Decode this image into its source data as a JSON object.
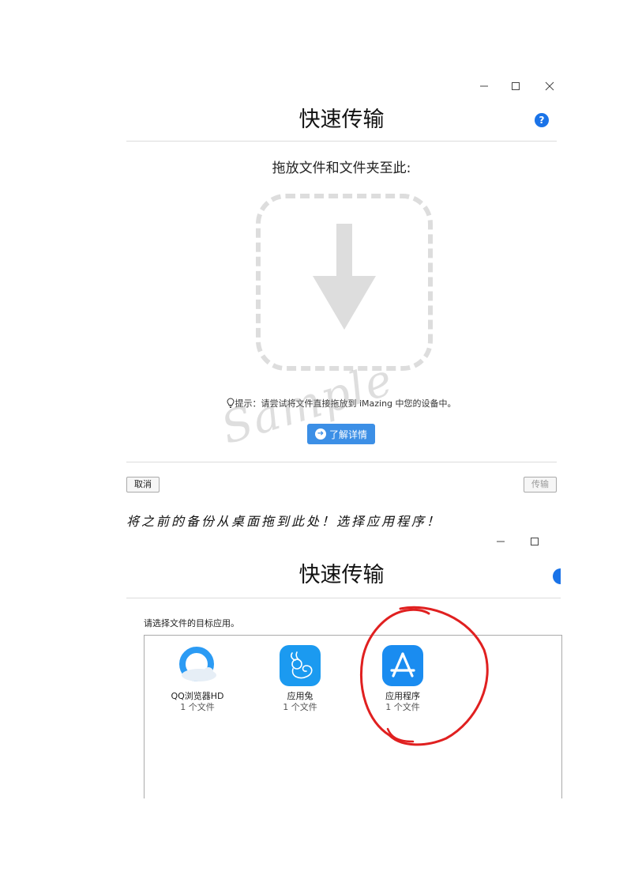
{
  "window1": {
    "title": "快速传输",
    "help_icon": "?",
    "drop_prompt": "拖放文件和文件夹至此:",
    "hint_icon": "lightbulb-icon",
    "hint_text": "提示：请尝试将文件直接拖放到 iMazing 中您的设备中。",
    "learn_more_label": "了解详情",
    "cancel_label": "取消",
    "transfer_label": "传输",
    "watermark": "Sample"
  },
  "caption": "将之前的备份从桌面拖到此处！选择应用程序！",
  "window2": {
    "title": "快速传输",
    "select_prompt": "请选择文件的目标应用。",
    "apps": [
      {
        "name": "QQ浏览器HD",
        "count": "1 个文件",
        "icon": "qq-browser-icon"
      },
      {
        "name": "应用兔",
        "count": "1 个文件",
        "icon": "rabbit-icon"
      },
      {
        "name": "应用程序",
        "count": "1 个文件",
        "icon": "app-store-icon"
      }
    ]
  },
  "colors": {
    "accent": "#1a73e8",
    "button_blue": "#3c8fe6",
    "annotation_red": "#e02020",
    "dropzone_gray": "#dddddd"
  }
}
